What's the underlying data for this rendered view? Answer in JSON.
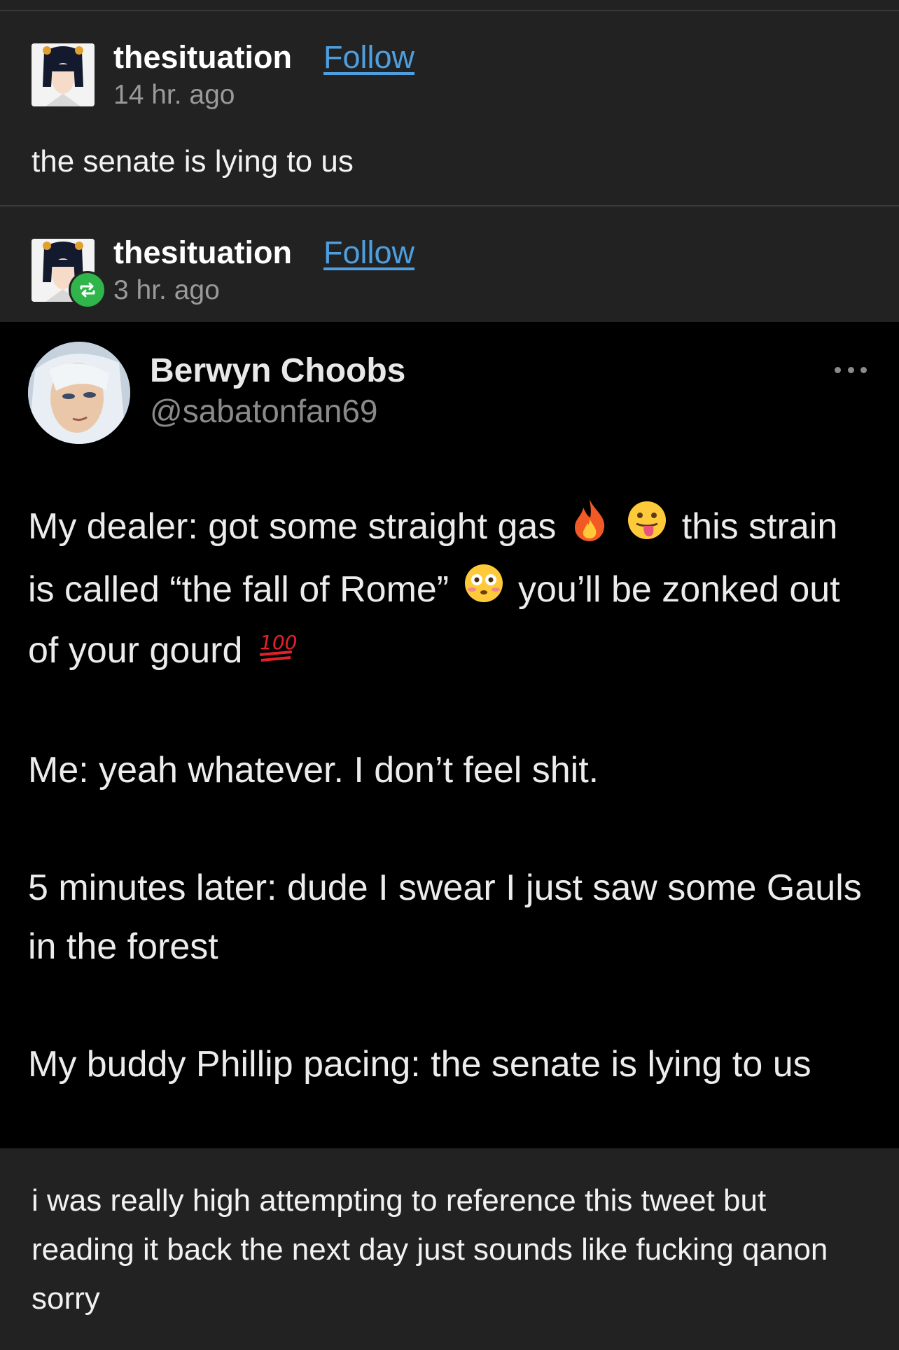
{
  "post1": {
    "username": "thesituation",
    "follow_label": "Follow",
    "time": "14 hr. ago",
    "text": "the senate is lying to us"
  },
  "post2": {
    "username": "thesituation",
    "follow_label": "Follow",
    "time": "3 hr. ago",
    "reblog_icon": "reblog-icon",
    "caption": "i was really high attempting to reference this tweet but reading it back the next day just sounds like fucking qanon sorry"
  },
  "tweet": {
    "name": "Berwyn Choobs",
    "handle": "@sabatonfan69",
    "lines": {
      "l1a": "My dealer: got some straight gas",
      "l1b": "this strain is called “the fall of Rome”",
      "l1c": "you’ll be zonked out of your gourd",
      "l2": "Me: yeah whatever. I don’t feel shit.",
      "l3": "5 minutes later: dude I swear I just saw some Gauls in the forest",
      "l4": "My buddy Phillip pacing: the senate is lying to us"
    },
    "emojis": [
      "fire-emoji",
      "tongue-emoji",
      "flushed-emoji",
      "hundred-emoji"
    ]
  },
  "colors": {
    "background": "#222222",
    "tweet_background": "#000000",
    "follow_link": "#4d9fe0",
    "reblog_badge": "#2fb54a"
  }
}
